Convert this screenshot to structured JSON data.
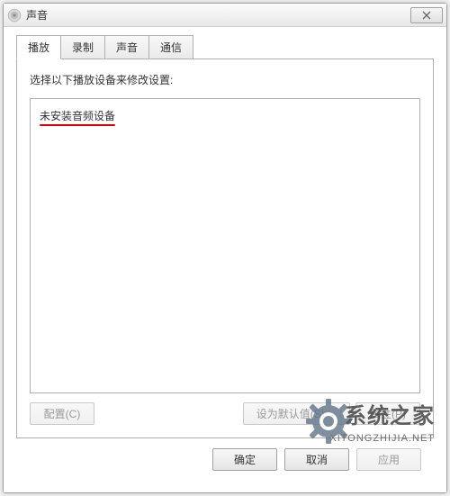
{
  "window": {
    "title": "声音"
  },
  "tabs": {
    "items": [
      {
        "label": "播放",
        "active": true
      },
      {
        "label": "录制",
        "active": false
      },
      {
        "label": "声音",
        "active": false
      },
      {
        "label": "通信",
        "active": false
      }
    ]
  },
  "content": {
    "instruction": "选择以下播放设备来修改设置:",
    "no_device_text": "未安装音频设备"
  },
  "buttons": {
    "configure": "配置(C)",
    "set_default": "设为默认值(S)",
    "properties": "属性(P)",
    "ok": "确定",
    "cancel": "取消",
    "apply": "应用"
  },
  "watermark": {
    "brand_zh": "系统之家",
    "brand_en": "XITONGZHIJIA.NET"
  }
}
